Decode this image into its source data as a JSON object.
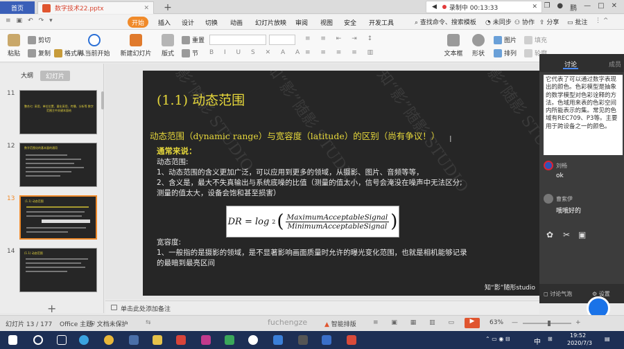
{
  "titlebar": {
    "home_tab": "首页",
    "file_tab": "数字技术22.pptx",
    "recorder": "录制中 00:13:33",
    "user": "鹏"
  },
  "menubar": {
    "tabs": [
      "开始",
      "插入",
      "设计",
      "切换",
      "动画",
      "幻灯片放映",
      "审阅",
      "视图",
      "安全",
      "开发工具"
    ],
    "active_tab": "开始",
    "search": "查找命令、搜索模板",
    "unsynced": "未同步",
    "collab": "协作",
    "share": "分享",
    "comment": "批注"
  },
  "ribbon": {
    "paste": "粘贴",
    "cut": "剪切",
    "copy": "复制",
    "format_painter": "格式刷",
    "from_current": "从当前开始",
    "new_slide": "新建幻灯片",
    "layout": "版式",
    "section": "节",
    "reset": "重置",
    "textbox": "文本框",
    "shape": "形状",
    "picture": "图片",
    "fill": "填充",
    "arrange": "排列",
    "outline": "轮廓"
  },
  "leftpanel": {
    "tab_outline": "大纲",
    "tab_slides": "幻灯片",
    "slides": [
      {
        "num": "11",
        "text": "整合七: 采用、单位位置、量化采用、传播、分析等 数字范围主中关键本面给"
      },
      {
        "num": "12",
        "text": "数字范围化的基本量的通用"
      },
      {
        "num": "13",
        "text": "(1.1) 动态范围"
      },
      {
        "num": "14",
        "text": "(1.1) 动态范围"
      }
    ],
    "selected_index": 2,
    "add_symbol": "+"
  },
  "slide": {
    "title": "(1.1) 动态范围",
    "subtitle": "动态范围（dynamic range）与宽容度（latitude）的区别（尚有争议！）",
    "section_heading": "通常来说：",
    "lines": [
      "动态范围:",
      "1、动态范围的含义更加广泛，可以应用到更多的领域，从摄影、图片、音频等等，",
      "2、含义是，最大不失真输出与系统底噪的比值（测量的值太小，信号会淹没在噪声中无法区分;",
      "测量的值太大，设备会饱和甚至损害）"
    ],
    "formula_lhs": "DR = log",
    "formula_base": "2",
    "formula_num": "MaximumAcceptableSignal",
    "formula_den": "MinimumAcceptableSignal",
    "lines2": [
      "宽容度:",
      "1、一般指的是摄影的领域，是不显著影响画面质量时允许的曝光变化范围，也就是相机能够记录",
      "的最暗到最亮区间"
    ],
    "footer": "知“影”随形studio",
    "watermark": "知“影”随影 STUDIO"
  },
  "notes": {
    "placeholder": "单击此处添加备注"
  },
  "statusbar": {
    "slide_count": "幻灯片 13 / 177",
    "theme": "Office 主题",
    "protect": "文档未保护",
    "center_label": "fuchengze",
    "smart_layout": "智能排版",
    "zoom": "63%"
  },
  "taskbar": {
    "lang": "中",
    "time": "19:52",
    "date": "2020/7/3"
  },
  "discussion": {
    "tab": "讨论",
    "tab2": "成员",
    "description": "它代表了可以通过数字表现出的颜色。色彩模型是抽象的数学模型对色彩诠释的方法。色域用来表的色彩空间内所能表示的集。常见的色域有REC709、P3等。主要用于跨设备之一的颜色。",
    "messages": [
      {
        "name": "刘畅",
        "text": "ok"
      },
      {
        "name": "曹紫伊",
        "text": "哦哦好的"
      }
    ],
    "bottom_left": "讨论气泡",
    "bottom_right": "设置",
    "colors": {
      "accent": "#4a8af4",
      "brand_orange": "#f08a2a",
      "slide_yellow": "#e7d83b"
    }
  }
}
